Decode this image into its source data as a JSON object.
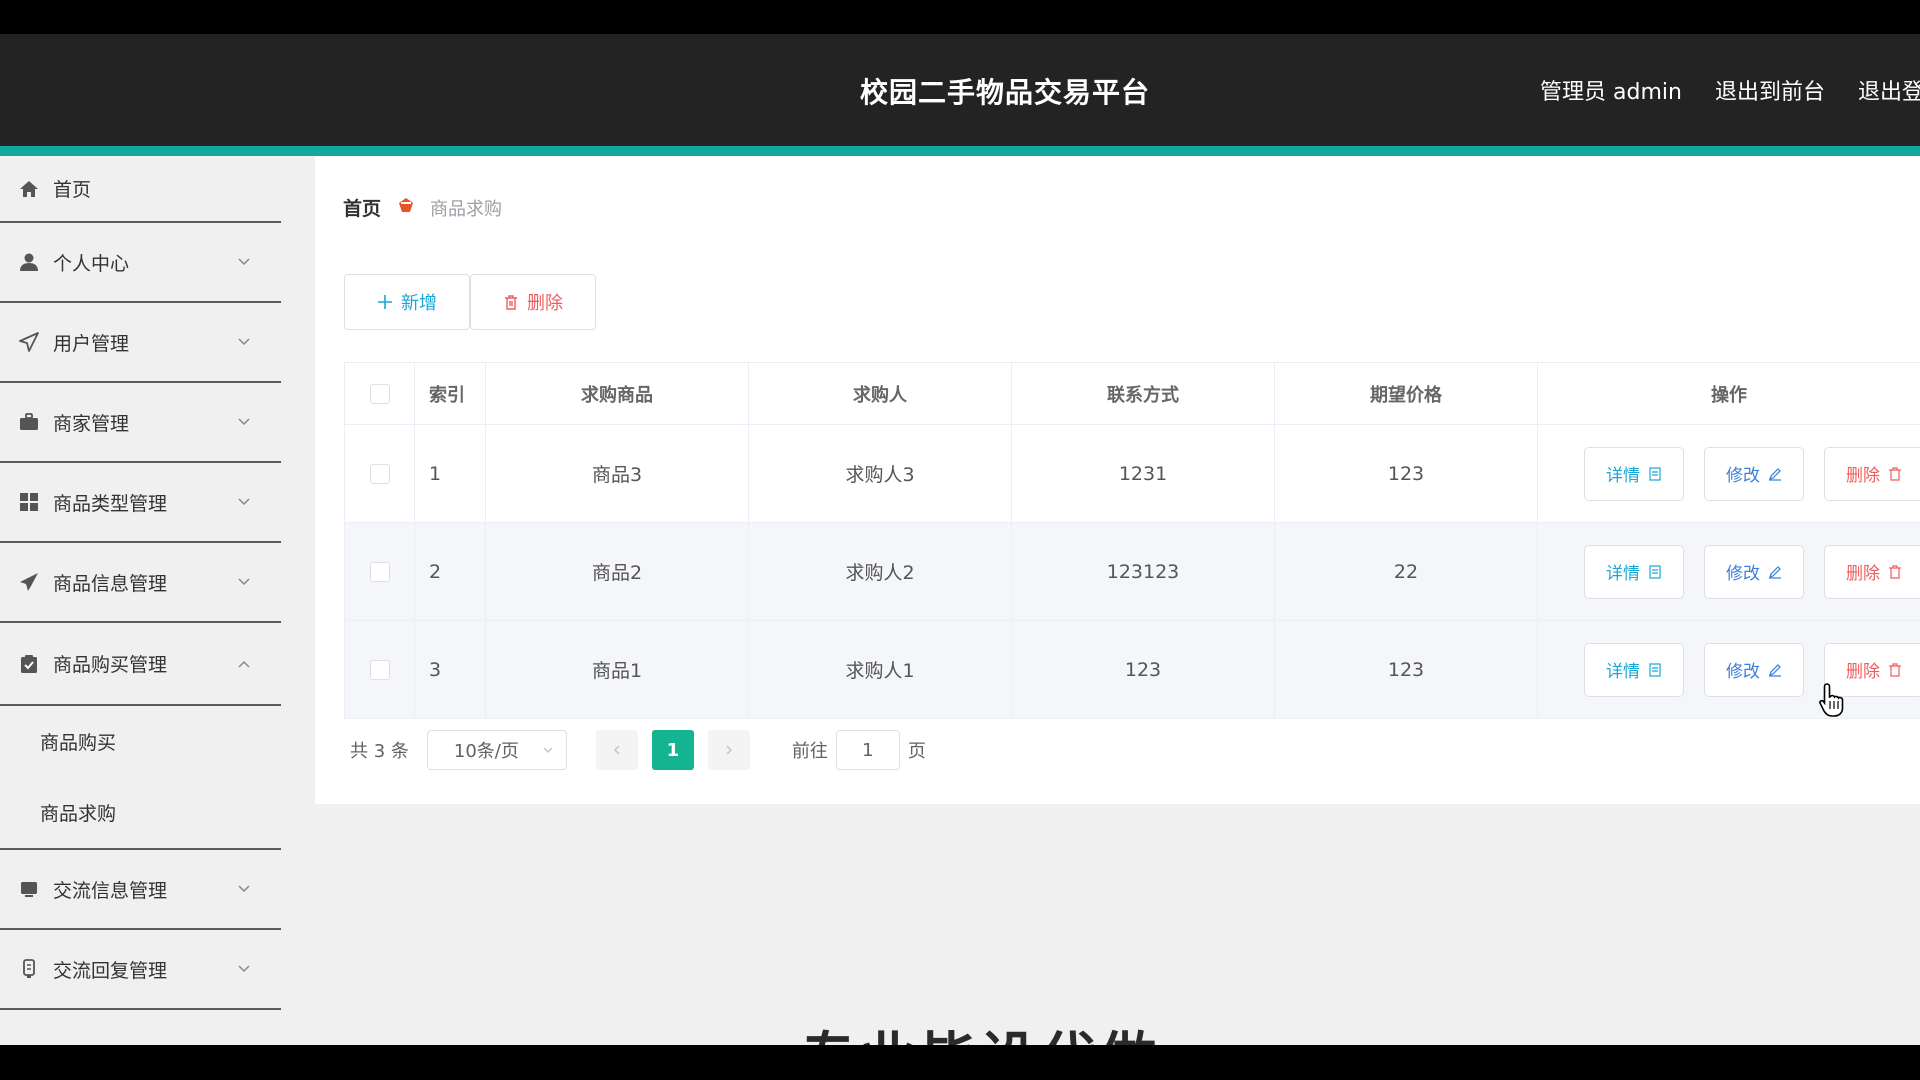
{
  "header": {
    "title": "校园二手物品交易平台",
    "admin_label": "管理员 admin",
    "to_front": "退出到前台",
    "logout": "退出登录"
  },
  "sidebar": {
    "items": [
      {
        "label": "首页",
        "icon": "home-icon"
      },
      {
        "label": "个人中心",
        "icon": "user-icon"
      },
      {
        "label": "用户管理",
        "icon": "send-icon"
      },
      {
        "label": "商家管理",
        "icon": "briefcase-icon"
      },
      {
        "label": "商品类型管理",
        "icon": "grid-icon"
      },
      {
        "label": "商品信息管理",
        "icon": "paper-plane-icon"
      },
      {
        "label": "商品购买管理",
        "icon": "clipboard-check-icon"
      },
      {
        "label": "交流信息管理",
        "icon": "monitor-icon"
      },
      {
        "label": "交流回复管理",
        "icon": "device-icon"
      }
    ],
    "submenu": [
      "商品购买",
      "商品求购"
    ]
  },
  "breadcrumb": {
    "home": "首页",
    "current": "商品求购"
  },
  "toolbar": {
    "add_label": "新增",
    "delete_label": "删除"
  },
  "table": {
    "headers": [
      "索引",
      "求购商品",
      "求购人",
      "联系方式",
      "期望价格",
      "操作"
    ],
    "rows": [
      {
        "index": "1",
        "goods": "商品3",
        "buyer": "求购人3",
        "contact": "1231",
        "price": "123"
      },
      {
        "index": "2",
        "goods": "商品2",
        "buyer": "求购人2",
        "contact": "123123",
        "price": "22"
      },
      {
        "index": "3",
        "goods": "商品1",
        "buyer": "求购人1",
        "contact": "123",
        "price": "123"
      }
    ],
    "ops": {
      "detail": "详情",
      "edit": "修改",
      "delete": "删除"
    }
  },
  "pagination": {
    "total": "共 3 条",
    "page_size": "10条/页",
    "current": "1",
    "goto_label": "前往",
    "goto_value": "1",
    "page_suffix": "页"
  },
  "watermark": "专业毕设代做",
  "colors": {
    "header_bg": "#232323",
    "accent": "#13a89e",
    "primary_blue": "#19a7d8",
    "danger": "#f25c5c",
    "page_active": "#13b48f"
  }
}
